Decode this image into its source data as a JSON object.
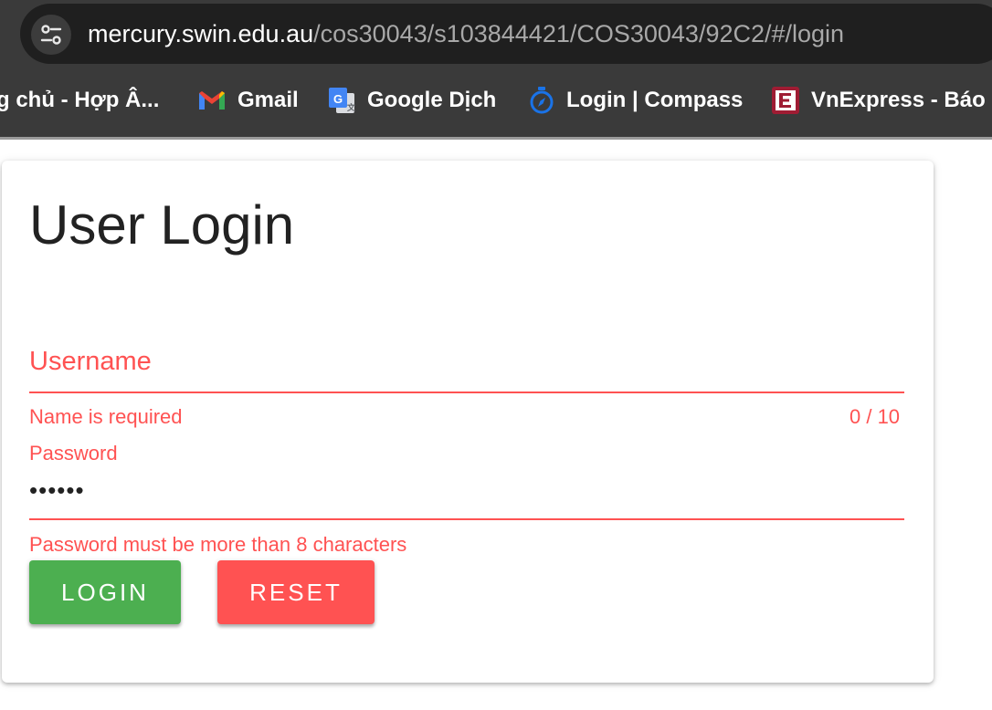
{
  "browser": {
    "url_domain": "mercury.swin.edu.au",
    "url_path": "/cos30043/s103844421/COS30043/92C2/#/login",
    "bookmarks": [
      {
        "label": "g chủ - Hợp Â...",
        "icon": "none"
      },
      {
        "label": "Gmail",
        "icon": "gmail-icon"
      },
      {
        "label": "Google Dịch",
        "icon": "google-translate-icon"
      },
      {
        "label": "Login | Compass",
        "icon": "compass-icon"
      },
      {
        "label": "VnExpress - Báo",
        "icon": "vnexpress-icon"
      }
    ]
  },
  "login": {
    "title": "User Login",
    "username_label": "Username",
    "username_value": "",
    "username_error": "Name is required",
    "username_counter": "0 / 10",
    "password_label": "Password",
    "password_value": "••••••",
    "password_error": "Password must be more than 8 characters",
    "login_button": "LOGIN",
    "reset_button": "RESET"
  },
  "colors": {
    "error": "#ff5252",
    "login_button": "#4caf50",
    "reset_button": "#ff5252",
    "browser_chrome": "#3a3a3a"
  }
}
